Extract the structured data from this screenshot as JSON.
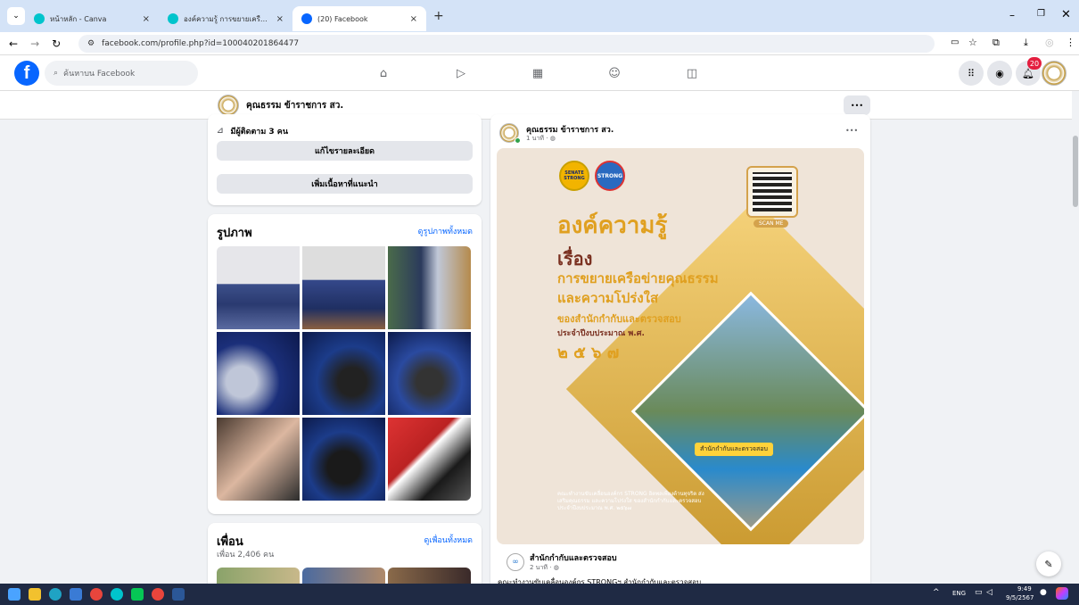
{
  "browser": {
    "tabs": [
      {
        "title": "หน้าหลัก - Canva"
      },
      {
        "title": "องค์ความรู้ การขยายเครือข่ายคุณธรร"
      },
      {
        "title": "(20) Facebook"
      }
    ],
    "url": "facebook.com/profile.php?id=100040201864477"
  },
  "fb": {
    "search_placeholder": "ค้นหาบน Facebook",
    "notif_count": "20",
    "profile_name": "คุณธรรม ข้าราชการ สว.",
    "more": "•••"
  },
  "intro": {
    "followers": "มีผู้ติดตาม 3 คน",
    "edit_details": "แก้ไขรายละเอียด",
    "add_featured": "เพิ่มเนื้อหาที่แนะนำ"
  },
  "photos": {
    "title": "รูปภาพ",
    "see_all": "ดูรูปภาพทั้งหมด"
  },
  "friends": {
    "title": "เพื่อน",
    "count": "เพื่อน 2,406 คน",
    "see_all": "ดูเพื่อนทั้งหมด"
  },
  "post": {
    "author": "คุณธรรม ข้าราชการ สว.",
    "time": "1 นาที · ",
    "more": "•••",
    "poster": {
      "logo1": "SENATE STRONG",
      "logo2": "STRONG",
      "scan": "SCAN ME",
      "title": "องค์ความรู้",
      "subject": "เรื่อง",
      "line1": "การขยายเครือข่ายคุณธรรม",
      "line2": "และความโปร่งใส",
      "line3": "ของสำนักกำกับและตรวจสอบ",
      "line4": "ประจำปีงบประมาณ พ.ศ.",
      "year": "๒ ๕ ๖ ๗",
      "banner": "สำนักกำกับและตรวจสอบ",
      "footer": "คณะทำงานขับเคลื่อนองค์กร STRONG อิตพลเพียงต้านทุจริต ส่งเสริมคุณธรรม และความโปร่งใส ของสำนักกำกับและตรวจสอบ ประจำปีงบประมาณ พ.ศ. ๒๕๖๗"
    },
    "shared_author": "สำนักกำกับและตรวจสอบ",
    "shared_time": "2 นาที · ",
    "shared_text": "คณะทำงานขับเคลื่อนองค์กร STRONGฯ สำนักกำกับและตรวจสอบ"
  },
  "taskbar": {
    "lang": "ENG",
    "time": "9:49",
    "date": "9/5/2567"
  }
}
